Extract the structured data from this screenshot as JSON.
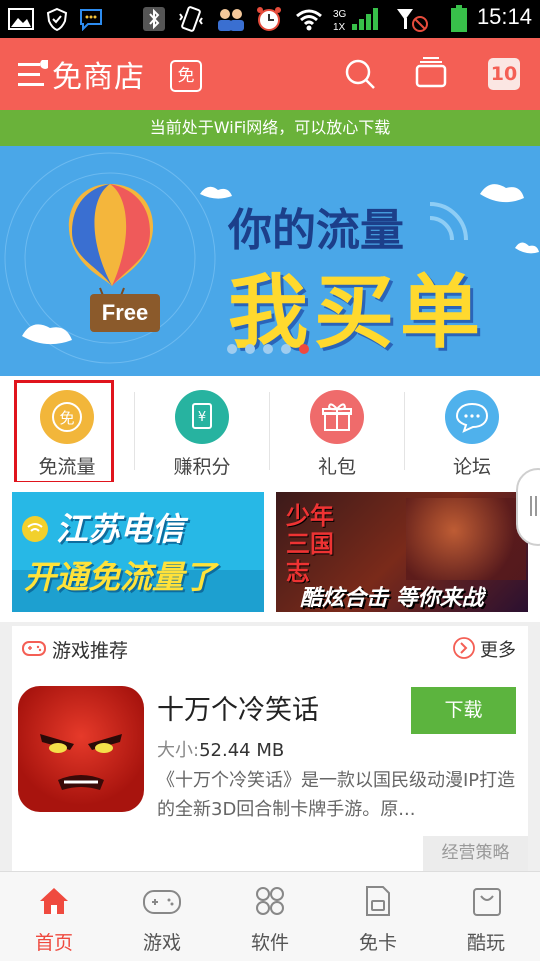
{
  "status_bar": {
    "time": "15:14",
    "network_label_top": "3G",
    "network_label_bottom": "1X",
    "icons": [
      "image-icon",
      "shield-icon",
      "chat-icon",
      "bluetooth-icon",
      "vibrate-icon",
      "contacts-icon",
      "alarm-icon",
      "wifi-icon",
      "signal-icon",
      "no-sim-icon",
      "battery-icon"
    ]
  },
  "header": {
    "title": "免商店",
    "free_badge": "免",
    "badge_count": "10"
  },
  "wifi_notice": "当前处于WiFi网络，可以放心下载",
  "banner": {
    "line1": "你的流量",
    "line2": "我买单",
    "balloon_tag": "Free",
    "slide_count": 5,
    "active_slide": 5
  },
  "categories": [
    {
      "label": "免流量",
      "icon_glyph": "免",
      "color": "#f2b63a"
    },
    {
      "label": "赚积分",
      "icon_glyph": "¥",
      "color": "#27b3a0"
    },
    {
      "label": "礼包",
      "icon_glyph": "gift",
      "color": "#ef6b6b"
    },
    {
      "label": "论坛",
      "icon_glyph": "…",
      "color": "#4fb1ec"
    }
  ],
  "promos": {
    "left": {
      "line1": "江苏电信",
      "line2": "开通免流量了"
    },
    "right": {
      "logo": "少年三国志",
      "slogan": "酷炫合击 等你来战"
    }
  },
  "recommend": {
    "section_title": "游戏推荐",
    "more_label": "更多",
    "app": {
      "name": "十万个冷笑话",
      "size_label": "大小:",
      "size_value": "52.44 MB",
      "description": "《十万个冷笑话》是一款以国民级动漫IP打造的全新3D回合制卡牌手游。原...",
      "download_label": "下载",
      "category_tag": "经营策略"
    }
  },
  "tabs": [
    {
      "label": "首页",
      "icon": "home-icon",
      "active": true
    },
    {
      "label": "游戏",
      "icon": "gamepad-icon",
      "active": false
    },
    {
      "label": "软件",
      "icon": "apps-icon",
      "active": false
    },
    {
      "label": "免卡",
      "icon": "sim-card-icon",
      "active": false
    },
    {
      "label": "酷玩",
      "icon": "bag-icon",
      "active": false
    }
  ],
  "colors": {
    "brand": "#f45f55",
    "wifi_bar": "#6ab23a",
    "download_button": "#5cb43e",
    "active_tab": "#ef4a3f",
    "highlight_box": "#e0141d"
  }
}
